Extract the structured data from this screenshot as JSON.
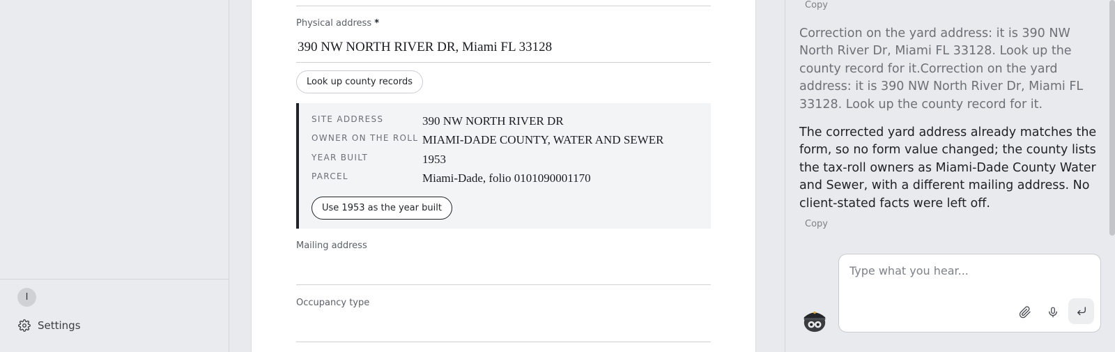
{
  "sidebar": {
    "avatar_initial": "I",
    "settings_label": "Settings"
  },
  "form": {
    "physical_address": {
      "label": "Physical address",
      "required_mark": "*",
      "value": "390 NW NORTH RIVER DR, Miami FL 33128"
    },
    "lookup_button_label": "Look up county records",
    "county_record": {
      "rows": [
        {
          "key": "SITE ADDRESS",
          "value": "390 NW NORTH RIVER DR"
        },
        {
          "key": "OWNER ON THE ROLL",
          "value": "MIAMI-DADE COUNTY, WATER AND SEWER"
        },
        {
          "key": "YEAR BUILT",
          "value": "1953"
        },
        {
          "key": "PARCEL",
          "value": "Miami-Dade, folio 0101090001170"
        }
      ],
      "use_year_button_label": "Use 1953 as the year built"
    },
    "mailing_address": {
      "label": "Mailing address",
      "value": ""
    },
    "occupancy_type": {
      "label": "Occupancy type",
      "value": ""
    }
  },
  "chat": {
    "top_copy_label": "Copy",
    "user_message": "Correction on the yard address: it is 390 NW North River Dr, Miami FL 33128. Look up the county record for it.Correction on the yard address: it is 390 NW North River Dr, Miami FL 33128. Look up the county record for it.",
    "assistant_message": "The corrected yard address already matches the form, so no form value changed; the county lists the tax-roll owners as Miami-Dade County Water and Sewer, with a different mailing address. No client-stated facts were left off.",
    "assistant_copy_label": "Copy",
    "composer_placeholder": "Type what you hear..."
  },
  "icons": {
    "settings": "gear-icon",
    "attach": "paperclip-icon",
    "mic": "microphone-icon",
    "send": "enter-return-icon",
    "assistant_avatar": "pilot-mascot-icon"
  }
}
